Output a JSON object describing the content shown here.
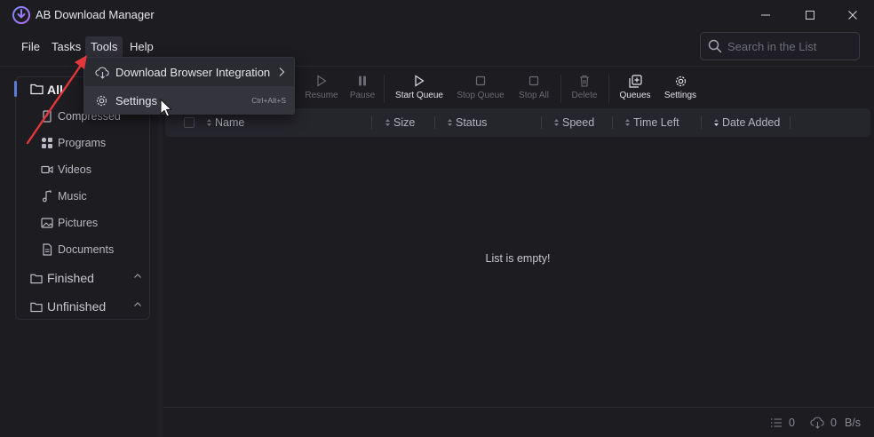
{
  "window": {
    "title": "AB Download Manager",
    "controls": [
      "minimize",
      "maximize",
      "close"
    ]
  },
  "menubar": {
    "items": [
      {
        "label": "File"
      },
      {
        "label": "Tasks"
      },
      {
        "label": "Tools",
        "active": true
      },
      {
        "label": "Help"
      }
    ]
  },
  "search": {
    "placeholder": "Search in the List",
    "value": ""
  },
  "tools_menu": {
    "items": [
      {
        "label": "Download Browser Integration",
        "icon": "cloud-download-icon",
        "has_submenu": true
      },
      {
        "label": "Settings",
        "icon": "gear-icon",
        "shortcut": "Ctrl+Alt+S",
        "highlighted": true
      }
    ]
  },
  "sidebar": {
    "all_label": "All",
    "categories": [
      {
        "label": "Compressed",
        "icon": "archive-icon"
      },
      {
        "label": "Programs",
        "icon": "apps-icon"
      },
      {
        "label": "Videos",
        "icon": "video-icon"
      },
      {
        "label": "Music",
        "icon": "music-icon"
      },
      {
        "label": "Pictures",
        "icon": "image-icon"
      },
      {
        "label": "Documents",
        "icon": "document-icon"
      }
    ],
    "groups": [
      {
        "label": "Finished",
        "expanded": true
      },
      {
        "label": "Unfinished",
        "expanded": true
      }
    ]
  },
  "toolbar": {
    "buttons": [
      {
        "label": "Resume",
        "icon": "play-icon",
        "enabled": false
      },
      {
        "label": "Pause",
        "icon": "pause-icon",
        "enabled": false
      },
      {
        "label": "Start Queue",
        "icon": "play-icon",
        "enabled": true
      },
      {
        "label": "Stop Queue",
        "icon": "stop-icon",
        "enabled": false
      },
      {
        "label": "Stop All",
        "icon": "stop-icon",
        "enabled": false
      },
      {
        "label": "Delete",
        "icon": "trash-icon",
        "enabled": false
      },
      {
        "label": "Queues",
        "icon": "queues-icon",
        "enabled": true
      },
      {
        "label": "Settings",
        "icon": "gear-icon",
        "enabled": true
      }
    ]
  },
  "table": {
    "columns": [
      "Name",
      "Size",
      "Status",
      "Speed",
      "Time Left",
      "Date Added"
    ],
    "sorted_column": "Date Added",
    "rows": [],
    "empty_message": "List is empty!"
  },
  "statusbar": {
    "active_count": "0",
    "download_count": "0",
    "speed_unit": "B/s"
  },
  "colors": {
    "background": "#1c1c21",
    "accent": "#5a7bd6",
    "annotation_arrow": "#e0383b"
  }
}
